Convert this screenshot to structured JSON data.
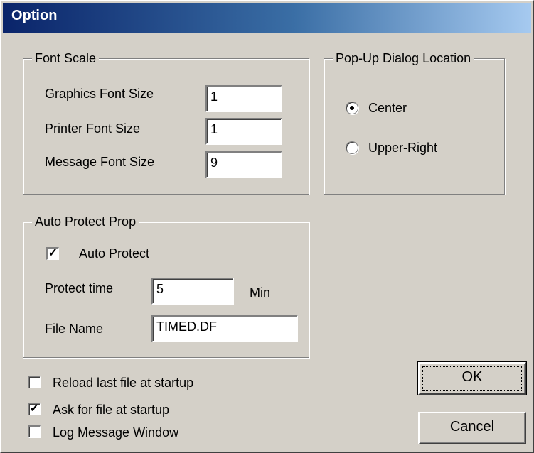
{
  "window": {
    "title": "Option"
  },
  "font_scale": {
    "legend": "Font Scale",
    "graphics_label": "Graphics Font Size",
    "graphics_value": "1",
    "printer_label": "Printer Font Size",
    "printer_value": "1",
    "message_label": "Message Font Size",
    "message_value": "9"
  },
  "popup": {
    "legend": "Pop-Up Dialog Location",
    "options": [
      {
        "label": "Center",
        "selected": true
      },
      {
        "label": "Upper-Right",
        "selected": false
      }
    ]
  },
  "auto_protect": {
    "legend": "Auto Protect Prop",
    "checkbox_label": "Auto Protect",
    "checked": true,
    "time_label": "Protect time",
    "time_value": "5",
    "time_unit": "Min",
    "file_label": "File Name",
    "file_value": "TIMED.DF"
  },
  "startup": {
    "reload_label": "Reload last file at startup",
    "reload_checked": false,
    "ask_label": "Ask for file at startup",
    "ask_checked": true,
    "log_label": "Log Message Window",
    "log_checked": false
  },
  "buttons": {
    "ok": "OK",
    "cancel": "Cancel"
  }
}
